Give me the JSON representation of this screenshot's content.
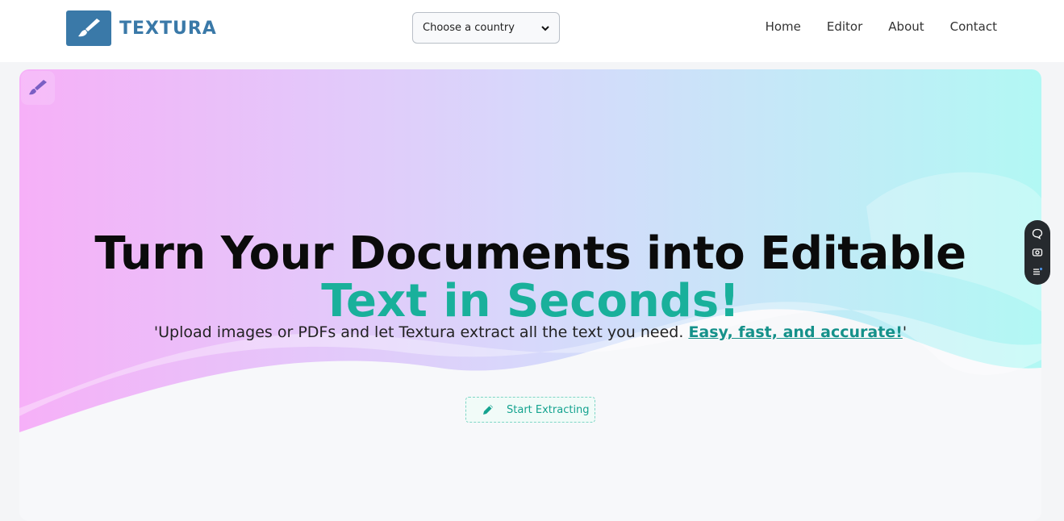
{
  "header": {
    "brand": "TEXTURA",
    "country_select": {
      "value": "Choose a country"
    },
    "nav": [
      "Home",
      "Editor",
      "About",
      "Contact"
    ]
  },
  "hero": {
    "title_line1": "Turn Your Documents into Editable",
    "title_line2": "Text in Seconds!",
    "subtitle_main": "'Upload images or PDFs and let Textura extract all the text you need. ",
    "subtitle_accent": "Easy, fast, and accurate!",
    "subtitle_end": "'",
    "cta_label": "Start Extracting"
  },
  "colors": {
    "brand": "#3a79a8",
    "accent": "#19b09b",
    "gradient_left": "#f5b3f5",
    "gradient_right": "#b3f8f4"
  },
  "icons": {
    "logo": "paintbrush-icon",
    "hero_badge": "paintbrush-icon",
    "cta": "pencil-icon",
    "tools": [
      "chat-icon",
      "camera-icon",
      "list-icon"
    ]
  }
}
